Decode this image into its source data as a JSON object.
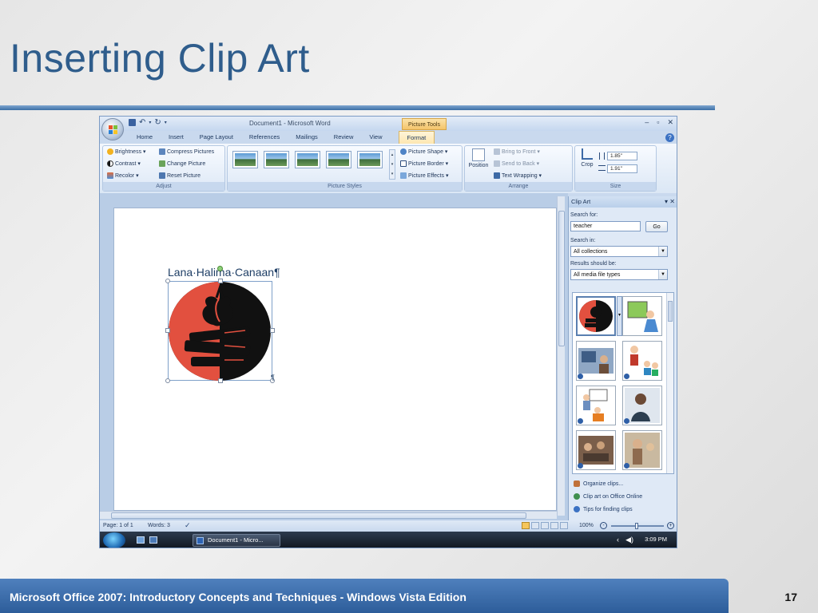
{
  "slide": {
    "title": "Inserting Clip Art",
    "footer": "Microsoft Office 2007: Introductory Concepts and Techniques - Windows Vista Edition",
    "page_number": "17"
  },
  "word": {
    "window_title": "Document1 - Microsoft Word",
    "contextual_tab": "Picture Tools",
    "window_controls": [
      "–",
      "▫",
      "✕"
    ],
    "tabs": [
      "Home",
      "Insert",
      "Page Layout",
      "References",
      "Mailings",
      "Review",
      "View",
      "Format"
    ],
    "active_tab": "Format",
    "ribbon": {
      "adjust": {
        "label": "Adjust",
        "brightness": "Brightness ▾",
        "contrast": "Contrast ▾",
        "recolor": "Recolor ▾",
        "compress": "Compress Pictures",
        "change": "Change Picture",
        "reset": "Reset Picture"
      },
      "picture_styles": {
        "label": "Picture Styles",
        "shape": "Picture Shape ▾",
        "border": "Picture Border ▾",
        "effects": "Picture Effects ▾"
      },
      "arrange": {
        "label": "Arrange",
        "position": "Position",
        "bring_front": "Bring to Front ▾",
        "send_back": "Send to Back ▾",
        "text_wrapping": "Text Wrapping ▾"
      },
      "size": {
        "label": "Size",
        "crop": "Crop",
        "height": "1.85\"",
        "width": "1.91\""
      }
    },
    "document_text": "Lana·Halima·Canaan¶",
    "pilcrow": "¶",
    "status": {
      "page": "Page: 1 of 1",
      "words": "Words: 3",
      "zoom": "100%"
    },
    "taskbar": {
      "task": "Document1 - Micro...",
      "clock": "3:09 PM"
    }
  },
  "clip_art_pane": {
    "title": "Clip Art",
    "search_label": "Search for:",
    "search_value": "teacher",
    "go_label": "Go",
    "search_in_label": "Search in:",
    "search_in_value": "All collections",
    "results_label": "Results should be:",
    "results_value": "All media file types",
    "links": [
      "Organize clips...",
      "Clip art on Office Online",
      "Tips for finding clips"
    ]
  }
}
